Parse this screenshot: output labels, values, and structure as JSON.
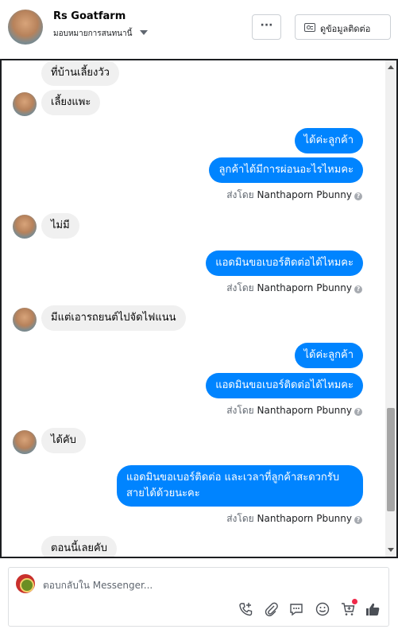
{
  "header": {
    "name": "Rs Goatfarm",
    "subtitle": "มอบหมายการสนทนานี้",
    "more_label": "···",
    "contact_label": "ดูข้อมูลติดต่อ"
  },
  "messages": [
    {
      "dir": "in",
      "text": "ที่บ้านเลี้ยงวัว"
    },
    {
      "dir": "in",
      "text": "เลี้ยงแพะ"
    },
    {
      "dir": "out",
      "text": "ได้ค่ะลูกค้า"
    },
    {
      "dir": "out",
      "text": "ลูกค้าได้มีการผ่อนอะไรไหมคะ"
    },
    {
      "dir": "in",
      "text": "ไม่มี"
    },
    {
      "dir": "out",
      "text": "แอดมินขอเบอร์ติดต่อได้ไหมคะ"
    },
    {
      "dir": "in",
      "text": "มีแต่เอารถยนต์ไปจัดไฟแนน"
    },
    {
      "dir": "out",
      "text": "ได้ค่ะลูกค้า"
    },
    {
      "dir": "out",
      "text": "แอดมินขอเบอร์ติดต่อได้ไหมคะ"
    },
    {
      "dir": "in",
      "text": "ได้คับ"
    },
    {
      "dir": "out",
      "text": "แอดมินขอเบอร์ติดต่อ และเวลาที่ลูกค้าสะดวกรับสายได้ด้วยนะคะ"
    },
    {
      "dir": "in",
      "text": "ตอนนี้เลยคับ"
    }
  ],
  "sent_by": {
    "prefix": "ส่งโดย",
    "name": "Nanthaporn Pbunny",
    "info": "?"
  },
  "composer": {
    "placeholder": "ตอบกลับใน Messenger..."
  },
  "icons": {
    "call": "phone-add-icon",
    "attach": "paperclip-icon",
    "saved_reply": "chat-bubble-icon",
    "emoji": "smiley-icon",
    "cart": "cart-icon",
    "like": "thumbs-up-icon"
  },
  "colors": {
    "outgoing_bubble": "#0084ff",
    "incoming_bubble": "#f0f0f0",
    "notification_dot": "#f02849"
  }
}
